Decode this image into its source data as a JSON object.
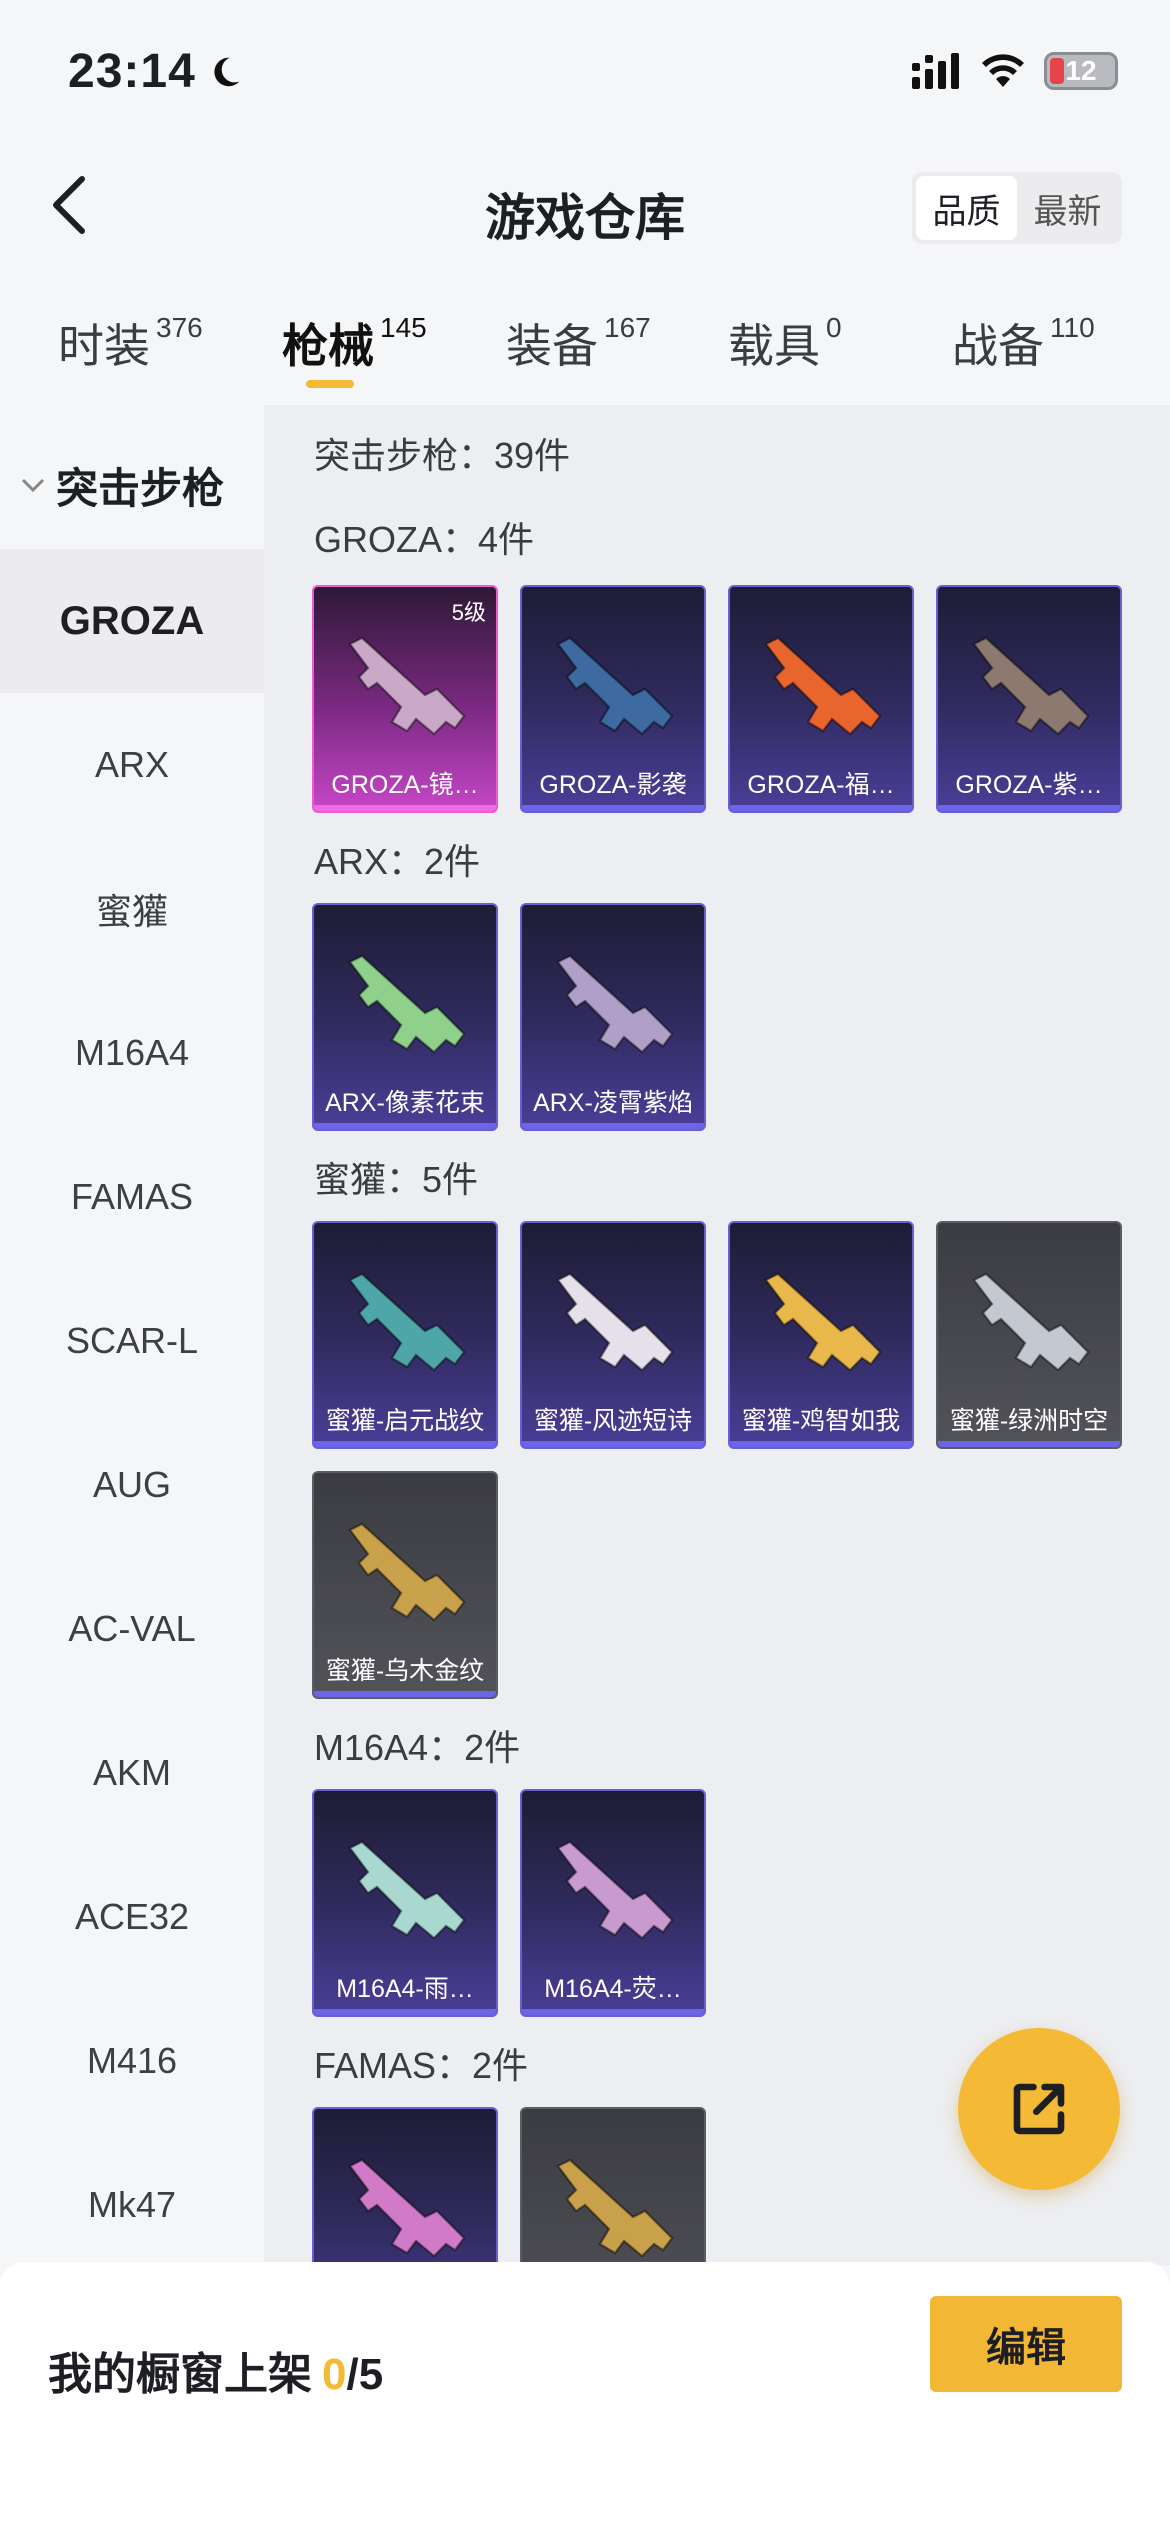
{
  "status_bar": {
    "time": "23:14",
    "battery": "12"
  },
  "header": {
    "title": "游戏仓库",
    "sort_quality": "品质",
    "sort_newest": "最新"
  },
  "tabs": [
    {
      "label": "时装",
      "count": "376"
    },
    {
      "label": "枪械",
      "count": "145"
    },
    {
      "label": "装备",
      "count": "167"
    },
    {
      "label": "载具",
      "count": "0"
    },
    {
      "label": "战备",
      "count": "110"
    }
  ],
  "sidebar": {
    "category": "突击步枪",
    "items": [
      "GROZA",
      "ARX",
      "蜜獾",
      "M16A4",
      "FAMAS",
      "SCAR-L",
      "AUG",
      "AC-VAL",
      "AKM",
      "ACE32",
      "M416",
      "Mk47"
    ]
  },
  "content": {
    "category_header": "突击步枪：39件",
    "groups": [
      {
        "header": "GROZA：4件",
        "items": [
          {
            "name": "GROZA-镜…",
            "level": "5级",
            "rarity": "pink",
            "gun_color": "#c9a8c8"
          },
          {
            "name": "GROZA-影袭",
            "rarity": "purple",
            "gun_color": "#3d6aa0"
          },
          {
            "name": "GROZA-福…",
            "rarity": "purple",
            "gun_color": "#e8652e"
          },
          {
            "name": "GROZA-紫…",
            "rarity": "purple",
            "gun_color": "#8c7a70"
          }
        ]
      },
      {
        "header": "ARX：2件",
        "items": [
          {
            "name": "ARX-像素花束",
            "rarity": "purple",
            "gun_color": "#8fd08a"
          },
          {
            "name": "ARX-凌霄紫焰",
            "rarity": "purple",
            "gun_color": "#b0a0c8"
          }
        ]
      },
      {
        "header": "蜜獾：5件",
        "items": [
          {
            "name": "蜜獾-启元战纹",
            "rarity": "purple",
            "gun_color": "#4fa6a8"
          },
          {
            "name": "蜜獾-风迹短诗",
            "rarity": "purple",
            "gun_color": "#e6e0ea"
          },
          {
            "name": "蜜獾-鸡智如我",
            "rarity": "purple",
            "gun_color": "#e8b84a"
          },
          {
            "name": "蜜獾-绿洲时空",
            "rarity": "gray",
            "gun_color": "#c4c8d0"
          },
          {
            "name": "蜜獾-乌木金纹",
            "rarity": "gray",
            "gun_color": "#c9a14a"
          }
        ]
      },
      {
        "header": "M16A4：2件",
        "items": [
          {
            "name": "M16A4-雨…",
            "rarity": "purple",
            "gun_color": "#a8d8d0"
          },
          {
            "name": "M16A4-荧…",
            "rarity": "purple",
            "gun_color": "#c89ad0"
          }
        ]
      },
      {
        "header": "FAMAS：2件",
        "items": [
          {
            "name": "",
            "rarity": "purple",
            "gun_color": "#d07ac8"
          },
          {
            "name": "",
            "rarity": "gray",
            "gun_color": "#c9a14a"
          }
        ]
      }
    ]
  },
  "bottom": {
    "showcase_label": "我的橱窗上架",
    "showcase_count": "0",
    "showcase_total": "/5",
    "edit_label": "编辑"
  },
  "colors": {
    "accent": "#f4b935",
    "rarity_purple": "#6b66e8",
    "rarity_pink": "#f06adf"
  }
}
